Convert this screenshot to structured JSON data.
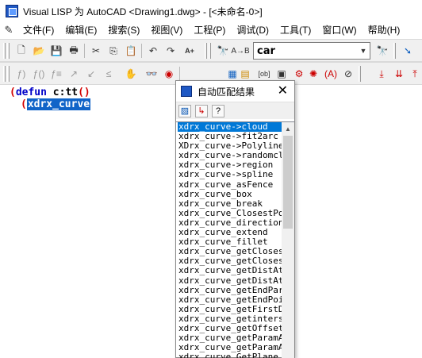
{
  "window": {
    "title": "Visual LISP 为 AutoCAD <Drawing1.dwg> - [<未命名-0>]"
  },
  "menu": [
    "文件(F)",
    "编辑(E)",
    "搜索(S)",
    "视图(V)",
    "工程(P)",
    "调试(D)",
    "工具(T)",
    "窗口(W)",
    "帮助(H)"
  ],
  "search": {
    "value": "car"
  },
  "editor": {
    "line1": {
      "open": "(",
      "keyword": "defun",
      "name": "c:tt",
      "args": "()"
    },
    "line2": {
      "open": "(",
      "selected": "xdrx_curve"
    }
  },
  "popup": {
    "title": "自动匹配结果",
    "close": "✕",
    "items": [
      "xdrx_curve->cloud",
      "xdrx_curve->fit2arc",
      "XDrx_curve->Polyline",
      "xdrx_curve->randomclo",
      "xdrx_curve->region",
      "xdrx_curve->spline",
      "xdrx_curve_asFence",
      "xdrx_curve_box",
      "xdrx_curve_break",
      "xdrx_curve_ClosestPoi",
      "xdrx_curve_direction",
      "xdrx_curve_extend",
      "xdrx_curve_fillet",
      "xdrx_curve_getClosest",
      "xdrx_curve_getClosest",
      "xdrx_curve_getDistAtP",
      "xdrx_curve_getDistAtP",
      "xdrx_curve_getEndPara",
      "xdrx_curve_getEndPoin",
      "xdrx_curve_getFirstDe",
      "xdrx_curve_getinters",
      "xdrx_curve_getOffsetC",
      "xdrx_curve_getParamAt",
      "xdrx_curve_getParamAt",
      "xdrx_curve_GetPlane"
    ],
    "selected_index": 0
  },
  "icons": [
    "menu-lead-icon",
    "new-icon",
    "open-icon",
    "save-icon",
    "print-icon",
    "cut-icon",
    "copy-icon",
    "paste-icon",
    "undo-icon",
    "redo-icon",
    "complete-word-icon",
    "find-icon",
    "replace-icon",
    "search-icon",
    "debug-icon"
  ]
}
